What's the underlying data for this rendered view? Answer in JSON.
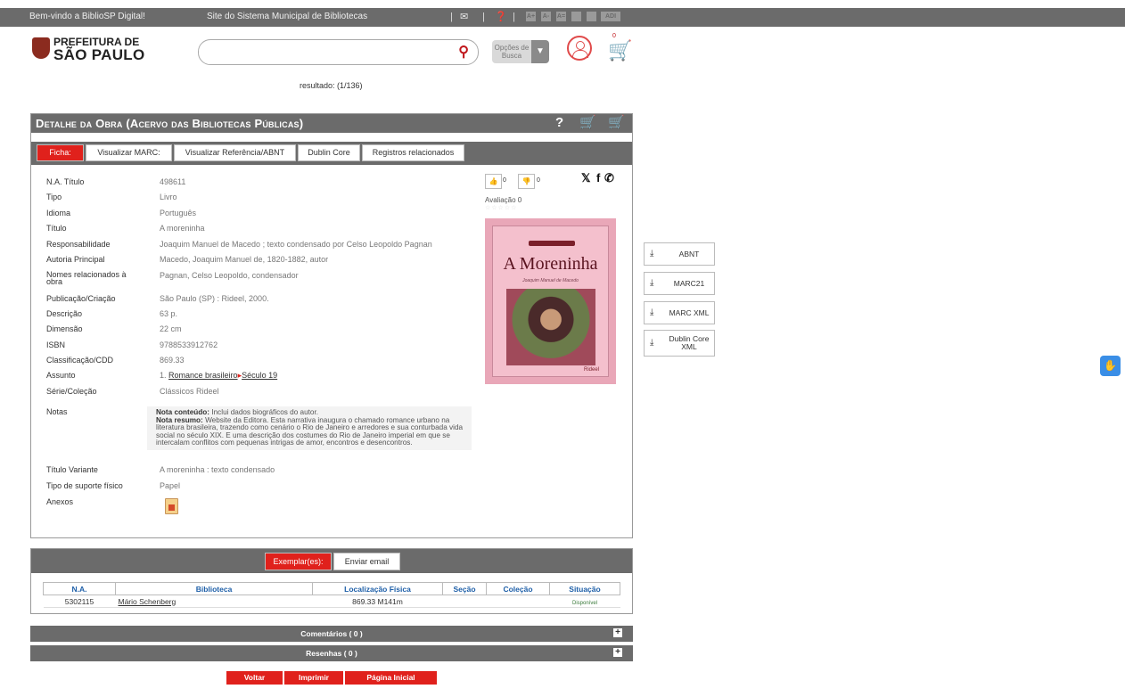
{
  "topbar": {
    "welcome": "Bem-vindo a BiblioSP Digital!",
    "site_label": "Site do Sistema Municipal de Bibliotecas",
    "acc_buttons": [
      "A+",
      "A-",
      "A=",
      "",
      "",
      "ADI"
    ]
  },
  "logo": {
    "line1": "PREFEITURA DE",
    "line2": "SÃO PAULO"
  },
  "search": {
    "value": "",
    "placeholder": "",
    "options_label": "Opções de Busca"
  },
  "header": {
    "cart_count": "0"
  },
  "resultado": "resultado: (1/136)",
  "panel": {
    "title": "Detalhe da Obra  (Acervo das Bibliotecas Públicas)",
    "help": "?"
  },
  "tabs": [
    "Ficha:",
    "Visualizar MARC:",
    "Visualizar Referência/ABNT",
    "Dublin Core",
    "Registros relacionados"
  ],
  "fields": [
    {
      "label": "N.A. Título",
      "value": "498611"
    },
    {
      "label": "Tipo",
      "value": "Livro"
    },
    {
      "label": "Idioma",
      "value": "Português"
    },
    {
      "label": "Título",
      "value": "A moreninha"
    },
    {
      "label": "Responsabilidade",
      "value": "Joaquim Manuel de Macedo ; texto condensado por Celso Leopoldo Pagnan"
    },
    {
      "label": "Autoria Principal",
      "value": "Macedo, Joaquim Manuel de, 1820-1882, autor"
    },
    {
      "label": "Nomes relacionados à obra",
      "value": "Pagnan, Celso Leopoldo, condensador"
    },
    {
      "label": "Publicação/Criação",
      "value": "São Paulo (SP) : Rideel, 2000."
    },
    {
      "label": "Descrição",
      "value": "63 p."
    },
    {
      "label": "Dimensão",
      "value": "22 cm"
    },
    {
      "label": "ISBN",
      "value": "9788533912762"
    },
    {
      "label": "Classificação/CDD",
      "value": "869.33"
    },
    {
      "label": "Assunto",
      "value": ""
    },
    {
      "label": "Série/Coleção",
      "value": "Clássicos Rideel"
    },
    {
      "label": "Notas",
      "value": ""
    },
    {
      "label": "Título Variante",
      "value": "A moreninha : texto condensado"
    },
    {
      "label": "Tipo de suporte físico",
      "value": "Papel"
    },
    {
      "label": "Anexos",
      "value": ""
    }
  ],
  "assunto": {
    "prefix": "1.",
    "link1": "Romance brasileiro",
    "link2": "Século 19"
  },
  "notas": {
    "conteudo_label": "Nota conteúdo:",
    "conteudo": "Inclui dados biográficos do autor.",
    "resumo_label": "Nota resumo:",
    "resumo": "Website da Editora. Esta narrativa inaugura o chamado romance urbano na literatura brasileira, trazendo como cenário o Rio de Janeiro e arredores e sua conturbada vida social no século XIX. E uma descrição dos costumes do Rio de Janeiro imperial em que se intercalam conflitos com pequenas intrigas de amor, encontros e desencontros."
  },
  "rating": {
    "likes": "0",
    "dislikes": "0",
    "avaliacao": "Avaliação 0",
    "stars": "☆☆☆☆☆"
  },
  "social": {
    "x": "𝕏",
    "f": "f",
    "wa": "✆"
  },
  "cover": {
    "title": "A Moreninha",
    "author": "Joaquim Manuel de Macedo",
    "publisher": "Rideel"
  },
  "downloads": [
    {
      "label": "ABNT"
    },
    {
      "label": "MARC21"
    },
    {
      "label": "MARC XML"
    },
    {
      "label": "Dublin Core XML"
    }
  ],
  "exemplares": {
    "tabs": [
      "Exemplar(es):",
      "Enviar email"
    ],
    "columns": [
      "N.A.",
      "Biblioteca",
      "Localização Física",
      "Seção",
      "Coleção",
      "Situação"
    ],
    "rows": [
      {
        "na": "5302115",
        "biblioteca": "Mário Schenberg",
        "localizacao": "869.33 M141m",
        "secao": "",
        "colecao": "",
        "situacao": "Disponível"
      }
    ]
  },
  "comentarios": "Comentários ( 0 )",
  "resenhas": "Resenhas ( 0 )",
  "buttons": {
    "voltar": "Voltar",
    "imprimir": "Imprimir",
    "inicial": "Página Inicial"
  },
  "colors": {
    "accent": "#e0211c",
    "bar": "#6b6b6b",
    "link_blue": "#1e5fa8"
  }
}
